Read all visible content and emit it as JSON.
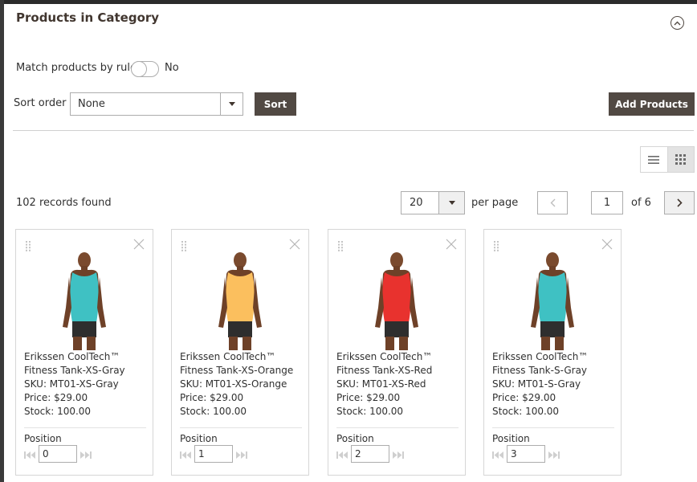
{
  "section": {
    "title": "Products in Category"
  },
  "match_rule": {
    "label": "Match products by rule",
    "value": "No"
  },
  "sort": {
    "label": "Sort order",
    "selected": "None",
    "button": "Sort"
  },
  "add_products": "Add Products",
  "records": {
    "text": "102 records found"
  },
  "pagination": {
    "per_page_value": "20",
    "per_page_label": "per page",
    "current_page": "1",
    "total_label": "of 6"
  },
  "products": [
    {
      "name_line1": "Erikssen CoolTech™",
      "name_line2": "Fitness Tank-XS-Gray",
      "sku": "SKU: MT01-XS-Gray",
      "price": "Price: $29.00",
      "stock": "Stock: 100.00",
      "position_label": "Position",
      "position": "0",
      "shirt_color": "#3fc1c3"
    },
    {
      "name_line1": "Erikssen CoolTech™",
      "name_line2": "Fitness Tank-XS-Orange",
      "sku": "SKU: MT01-XS-Orange",
      "price": "Price: $29.00",
      "stock": "Stock: 100.00",
      "position_label": "Position",
      "position": "1",
      "shirt_color": "#fbbf5e"
    },
    {
      "name_line1": "Erikssen CoolTech™",
      "name_line2": "Fitness Tank-XS-Red",
      "sku": "SKU: MT01-XS-Red",
      "price": "Price: $29.00",
      "stock": "Stock: 100.00",
      "position_label": "Position",
      "position": "2",
      "shirt_color": "#e8322e"
    },
    {
      "name_line1": "Erikssen CoolTech™",
      "name_line2": "Fitness Tank-S-Gray",
      "sku": "SKU: MT01-S-Gray",
      "price": "Price: $29.00",
      "stock": "Stock: 100.00",
      "position_label": "Position",
      "position": "3",
      "shirt_color": "#3fc1c3"
    }
  ],
  "icons": {
    "collapse": "collapse-circle-icon",
    "dropdown": "chevron-down-icon",
    "prev": "chevron-left-icon",
    "next": "chevron-right-icon",
    "list_view": "list-view-icon",
    "grid_view": "grid-view-icon",
    "drag": "drag-handle-icon",
    "remove": "close-icon",
    "move_top": "move-top-icon",
    "move_bottom": "move-bottom-icon"
  },
  "colors": {
    "button_dark": "#514943",
    "border": "#adadad",
    "title": "#41362f"
  }
}
